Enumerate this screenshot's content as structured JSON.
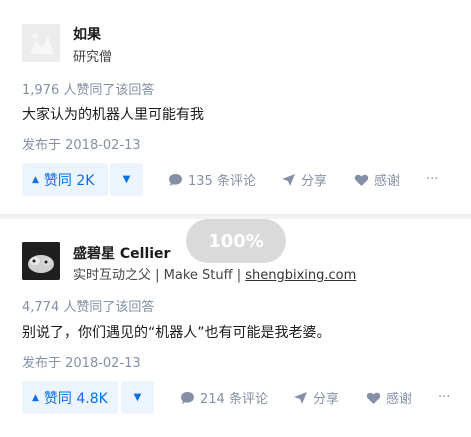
{
  "answers": [
    {
      "author_name": "如果",
      "author_headline": "研究僧",
      "votes_text": "1,976 人赞同了该回答",
      "content": "大家认为的机器人里可能有我",
      "date": "发布于 2018-02-13",
      "vote_label": "赞同 2K",
      "comment_label": "135 条评论",
      "share_label": "分享",
      "thanks_label": "感谢",
      "more_label": "···"
    },
    {
      "author_name": "盛碧星 Cellier",
      "author_headline_prefix": "实时互动之父 | Make Stuff | ",
      "author_headline_link": "shengbixing.com",
      "votes_text": "4,774 人赞同了该回答",
      "content": "别说了，你们遇见的“机器人”也有可能是我老婆。",
      "date": "发布于 2018-02-13",
      "vote_label": "赞同 4.8K",
      "comment_label": "214 条评论",
      "share_label": "分享",
      "thanks_label": "感谢",
      "more_label": "···"
    }
  ],
  "zoom_overlay": "100%",
  "icons": {
    "upvote": "triangle-up-icon",
    "downvote": "triangle-down-icon",
    "comment": "comment-bubble-icon",
    "share": "paper-plane-icon",
    "thanks": "heart-icon",
    "more": "more-dots-icon"
  },
  "colors": {
    "accent": "#0a70e6",
    "accent_bg": "#ebf4ff",
    "muted": "#8590a6"
  }
}
